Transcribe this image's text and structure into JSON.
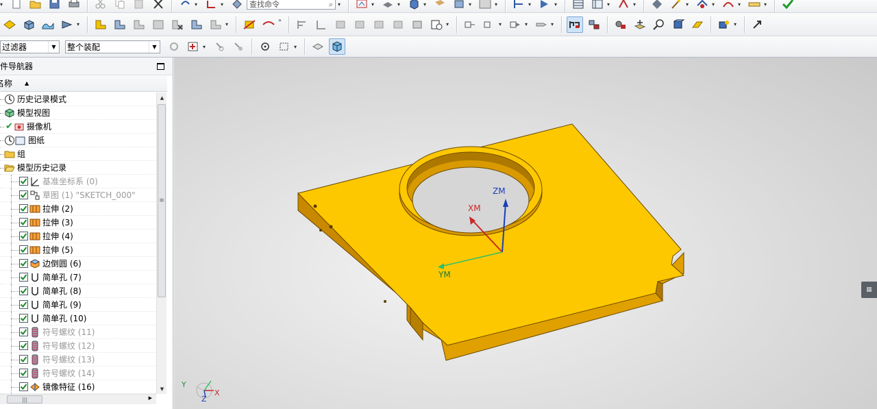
{
  "toolbar1": {
    "find_placeholder": "查找命令"
  },
  "toolbar3": {
    "filter_value": "过滤器",
    "scope_value": "整个装配"
  },
  "navigator": {
    "title": "部件导航器",
    "column_name": "名称",
    "items": [
      {
        "label": "历史记录模式",
        "icon": "clock-icon",
        "level": 0,
        "dim": false,
        "checked": null
      },
      {
        "label": "模型视图",
        "icon": "model-views-icon",
        "level": 0,
        "dim": false,
        "checked": null
      },
      {
        "label": "摄像机",
        "icon": "camera-icon",
        "level": 0,
        "dim": false,
        "checked": "green-tick"
      },
      {
        "label": "图纸",
        "icon": "drawing-icon",
        "level": 0,
        "dim": false,
        "checked": null
      },
      {
        "label": "组",
        "icon": "folder-icon",
        "level": 0,
        "dim": false,
        "checked": null
      },
      {
        "label": "模型历史记录",
        "icon": "folder-open-icon",
        "level": 0,
        "dim": false,
        "checked": null
      },
      {
        "label": "基准坐标系 (0)",
        "icon": "datum-csys-icon",
        "level": 1,
        "dim": true,
        "checked": true
      },
      {
        "label": "草图 (1) \"SKETCH_000\"",
        "icon": "sketch-icon",
        "level": 1,
        "dim": true,
        "checked": true
      },
      {
        "label": "拉伸 (2)",
        "icon": "extrude-icon",
        "level": 1,
        "dim": false,
        "checked": true
      },
      {
        "label": "拉伸 (3)",
        "icon": "extrude-icon",
        "level": 1,
        "dim": false,
        "checked": true
      },
      {
        "label": "拉伸 (4)",
        "icon": "extrude-icon",
        "level": 1,
        "dim": false,
        "checked": true
      },
      {
        "label": "拉伸 (5)",
        "icon": "extrude-icon",
        "level": 1,
        "dim": false,
        "checked": true
      },
      {
        "label": "边倒圆 (6)",
        "icon": "edge-blend-icon",
        "level": 1,
        "dim": false,
        "checked": true
      },
      {
        "label": "简单孔 (7)",
        "icon": "hole-icon",
        "level": 1,
        "dim": false,
        "checked": true
      },
      {
        "label": "简单孔 (8)",
        "icon": "hole-icon",
        "level": 1,
        "dim": false,
        "checked": true
      },
      {
        "label": "简单孔 (9)",
        "icon": "hole-icon",
        "level": 1,
        "dim": false,
        "checked": true
      },
      {
        "label": "简单孔 (10)",
        "icon": "hole-icon",
        "level": 1,
        "dim": false,
        "checked": true
      },
      {
        "label": "符号螺纹 (11)",
        "icon": "thread-icon",
        "level": 1,
        "dim": true,
        "checked": true
      },
      {
        "label": "符号螺纹 (12)",
        "icon": "thread-icon",
        "level": 1,
        "dim": true,
        "checked": true
      },
      {
        "label": "符号螺纹 (13)",
        "icon": "thread-icon",
        "level": 1,
        "dim": true,
        "checked": true
      },
      {
        "label": "符号螺纹 (14)",
        "icon": "thread-icon",
        "level": 1,
        "dim": true,
        "checked": true
      },
      {
        "label": "镜像特征 (16)",
        "icon": "mirror-feature-icon",
        "level": 1,
        "dim": false,
        "checked": true
      }
    ]
  },
  "viewport": {
    "axis_labels": {
      "zm": "ZM",
      "xm": "XM",
      "ym": "YM"
    },
    "triad_labels": {
      "x": "X",
      "y": "Y",
      "z": "Z"
    },
    "colors": {
      "part_top": "#fec800",
      "part_front": "#e6a800",
      "part_side": "#c98a00",
      "zm_axis": "#1a3fb8",
      "xm_axis": "#c82828",
      "ym_axis": "#2fbf6a"
    }
  }
}
